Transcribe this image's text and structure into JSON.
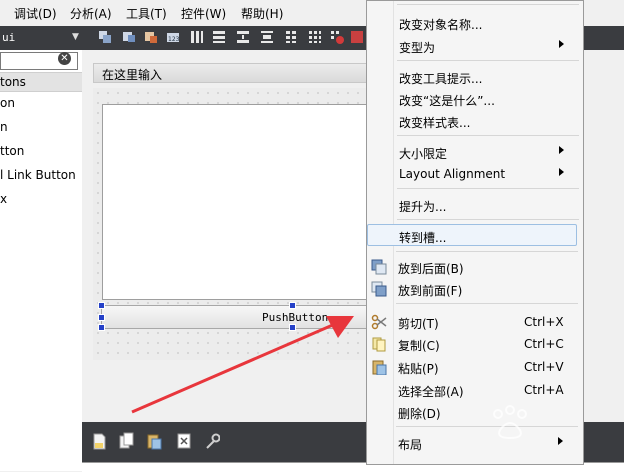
{
  "menubar": {
    "items": [
      "调试(D)",
      "分析(A)",
      "工具(T)",
      "控件(W)",
      "帮助(H)"
    ]
  },
  "toolbar": {
    "left_label": "ui"
  },
  "left_panel": {
    "filter_clear_glyph": "✕",
    "group_header": "tons",
    "items": [
      "on",
      "n",
      "tton",
      "l Link Button",
      "x"
    ]
  },
  "form": {
    "menubar_placeholder": "在这里输入",
    "pushbutton_label": "PushButton"
  },
  "context_menu": {
    "items": [
      {
        "label": "改变对象名称...",
        "submenu": false
      },
      {
        "label": "变型为",
        "submenu": true
      },
      {
        "label": "改变工具提示...",
        "submenu": false
      },
      {
        "label": "改变“这是什么”...",
        "submenu": false
      },
      {
        "label": "改变样式表...",
        "submenu": false
      },
      {
        "label": "大小限定",
        "submenu": true
      },
      {
        "label": "Layout Alignment",
        "submenu": true
      },
      {
        "label": "提升为...",
        "submenu": false
      },
      {
        "label": "转到槽...",
        "submenu": false,
        "highlighted": true
      },
      {
        "label": "放到后面(B)",
        "submenu": false,
        "icon": "send-to-back-icon"
      },
      {
        "label": "放到前面(F)",
        "submenu": false,
        "icon": "bring-to-front-icon"
      },
      {
        "label": "剪切(T)",
        "shortcut": "Ctrl+X",
        "icon": "scissors-icon"
      },
      {
        "label": "复制(C)",
        "shortcut": "Ctrl+C",
        "icon": "copy-icon"
      },
      {
        "label": "粘贴(P)",
        "shortcut": "Ctrl+V",
        "icon": "paste-icon"
      },
      {
        "label": "选择全部(A)",
        "shortcut": "Ctrl+A"
      },
      {
        "label": "删除(D)",
        "submenu": false
      },
      {
        "label": "布局",
        "submenu": true
      }
    ]
  },
  "colors": {
    "toolbar_bg": "#3a3c40",
    "menu_highlight": "#eef4fb",
    "selection_handle": "#2541c8",
    "arrow_annotation": "#e8363c"
  }
}
